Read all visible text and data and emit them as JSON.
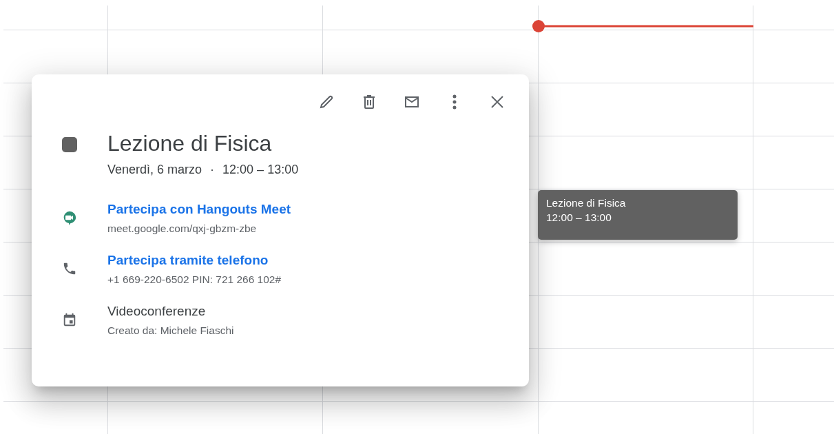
{
  "event": {
    "title": "Lezione di Fisica",
    "color": "#616161",
    "date": "Venerdì, 6 marzo",
    "separator": "·",
    "time": "12:00 – 13:00"
  },
  "details": [
    {
      "kind": "meet",
      "title": "Partecipa con Hangouts Meet",
      "subtitle": "meet.google.com/qxj-gbzm-zbe"
    },
    {
      "kind": "phone",
      "title": "Partecipa tramite telefono",
      "subtitle": "+1 669-220-6502 PIN: 721 266 102#"
    },
    {
      "kind": "calendar",
      "title": "Videoconferenze",
      "subtitle": "Creato da: Michele Fiaschi"
    }
  ],
  "tooltip": {
    "title": "Lezione di Fisica",
    "time": "12:00 – 13:00"
  }
}
